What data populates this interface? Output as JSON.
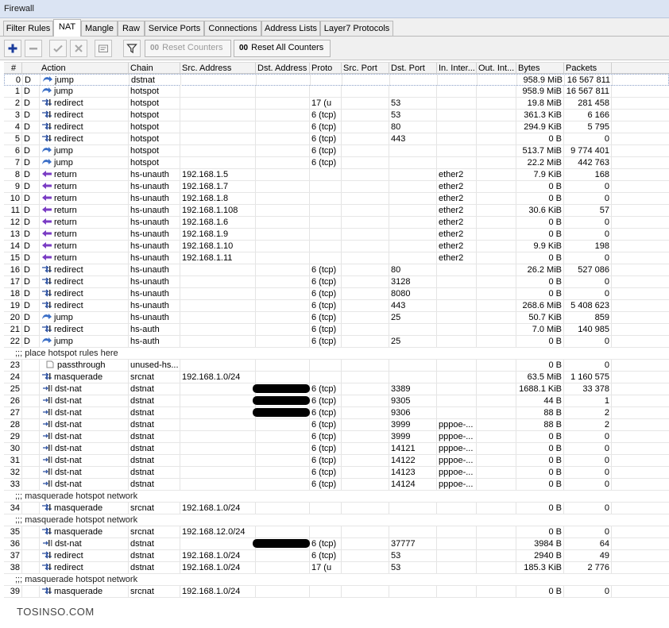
{
  "window": {
    "title": "Firewall"
  },
  "tabs": [
    {
      "label": "Filter Rules",
      "active": false
    },
    {
      "label": "NAT",
      "active": true
    },
    {
      "label": "Mangle",
      "active": false
    },
    {
      "label": "Raw",
      "active": false
    },
    {
      "label": "Service Ports",
      "active": false
    },
    {
      "label": "Connections",
      "active": false
    },
    {
      "label": "Address Lists",
      "active": false
    },
    {
      "label": "Layer7 Protocols",
      "active": false
    }
  ],
  "toolbar": {
    "icons": [
      "add-icon",
      "remove-icon",
      "enable-icon",
      "disable-icon",
      "comment-icon",
      "filter-icon"
    ],
    "reset_counters_prefix": "00",
    "reset_counters_label": "Reset Counters",
    "reset_all_prefix": "00",
    "reset_all_label": "Reset All Counters"
  },
  "columns": [
    "#",
    "Action",
    "Chain",
    "Src. Address",
    "Dst. Address",
    "Proto",
    "Src. Port",
    "Dst. Port",
    "In. Inter...",
    "Out. Int...",
    "Bytes",
    "Packets"
  ],
  "colors": {
    "accent_plus": "#1a3c9c",
    "redirect_arrow": "#2a4fa0",
    "return_arrow": "#7a3cc4",
    "jump_arrow": "#3b6fc7"
  },
  "rows": [
    {
      "type": "rule",
      "num": "0",
      "flag": "D",
      "action": "jump",
      "icon": "jump",
      "chain": "dstnat",
      "src": "",
      "dst": "",
      "proto": "",
      "sport": "",
      "dport": "",
      "inif": "",
      "outif": "",
      "bytes": "958.9 MiB",
      "packets": "16 567 811"
    },
    {
      "type": "rule",
      "num": "1",
      "flag": "D",
      "action": "jump",
      "icon": "jump",
      "chain": "hotspot",
      "src": "",
      "dst": "",
      "proto": "",
      "sport": "",
      "dport": "",
      "inif": "",
      "outif": "",
      "bytes": "958.9 MiB",
      "packets": "16 567 811"
    },
    {
      "type": "rule",
      "num": "2",
      "flag": "D",
      "action": "redirect",
      "icon": "redirect",
      "chain": "hotspot",
      "src": "",
      "dst": "",
      "proto": "17 (u",
      "sport": "",
      "dport": "53",
      "inif": "",
      "outif": "",
      "bytes": "19.8 MiB",
      "packets": "281 458"
    },
    {
      "type": "rule",
      "num": "3",
      "flag": "D",
      "action": "redirect",
      "icon": "redirect",
      "chain": "hotspot",
      "src": "",
      "dst": "",
      "proto": "6 (tcp)",
      "sport": "",
      "dport": "53",
      "inif": "",
      "outif": "",
      "bytes": "361.3 KiB",
      "packets": "6 166"
    },
    {
      "type": "rule",
      "num": "4",
      "flag": "D",
      "action": "redirect",
      "icon": "redirect",
      "chain": "hotspot",
      "src": "",
      "dst": "",
      "proto": "6 (tcp)",
      "sport": "",
      "dport": "80",
      "inif": "",
      "outif": "",
      "bytes": "294.9 KiB",
      "packets": "5 795"
    },
    {
      "type": "rule",
      "num": "5",
      "flag": "D",
      "action": "redirect",
      "icon": "redirect",
      "chain": "hotspot",
      "src": "",
      "dst": "",
      "proto": "6 (tcp)",
      "sport": "",
      "dport": "443",
      "inif": "",
      "outif": "",
      "bytes": "0 B",
      "packets": "0"
    },
    {
      "type": "rule",
      "num": "6",
      "flag": "D",
      "action": "jump",
      "icon": "jump",
      "chain": "hotspot",
      "src": "",
      "dst": "",
      "proto": "6 (tcp)",
      "sport": "",
      "dport": "",
      "inif": "",
      "outif": "",
      "bytes": "513.7 MiB",
      "packets": "9 774 401"
    },
    {
      "type": "rule",
      "num": "7",
      "flag": "D",
      "action": "jump",
      "icon": "jump",
      "chain": "hotspot",
      "src": "",
      "dst": "",
      "proto": "6 (tcp)",
      "sport": "",
      "dport": "",
      "inif": "",
      "outif": "",
      "bytes": "22.2 MiB",
      "packets": "442 763"
    },
    {
      "type": "rule",
      "num": "8",
      "flag": "D",
      "action": "return",
      "icon": "return",
      "chain": "hs-unauth",
      "src": "192.168.1.5",
      "dst": "",
      "proto": "",
      "sport": "",
      "dport": "",
      "inif": "ether2",
      "outif": "",
      "bytes": "7.9 KiB",
      "packets": "168"
    },
    {
      "type": "rule",
      "num": "9",
      "flag": "D",
      "action": "return",
      "icon": "return",
      "chain": "hs-unauth",
      "src": "192.168.1.7",
      "dst": "",
      "proto": "",
      "sport": "",
      "dport": "",
      "inif": "ether2",
      "outif": "",
      "bytes": "0 B",
      "packets": "0"
    },
    {
      "type": "rule",
      "num": "10",
      "flag": "D",
      "action": "return",
      "icon": "return",
      "chain": "hs-unauth",
      "src": "192.168.1.8",
      "dst": "",
      "proto": "",
      "sport": "",
      "dport": "",
      "inif": "ether2",
      "outif": "",
      "bytes": "0 B",
      "packets": "0"
    },
    {
      "type": "rule",
      "num": "11",
      "flag": "D",
      "action": "return",
      "icon": "return",
      "chain": "hs-unauth",
      "src": "192.168.1.108",
      "dst": "",
      "proto": "",
      "sport": "",
      "dport": "",
      "inif": "ether2",
      "outif": "",
      "bytes": "30.6 KiB",
      "packets": "57"
    },
    {
      "type": "rule",
      "num": "12",
      "flag": "D",
      "action": "return",
      "icon": "return",
      "chain": "hs-unauth",
      "src": "192.168.1.6",
      "dst": "",
      "proto": "",
      "sport": "",
      "dport": "",
      "inif": "ether2",
      "outif": "",
      "bytes": "0 B",
      "packets": "0"
    },
    {
      "type": "rule",
      "num": "13",
      "flag": "D",
      "action": "return",
      "icon": "return",
      "chain": "hs-unauth",
      "src": "192.168.1.9",
      "dst": "",
      "proto": "",
      "sport": "",
      "dport": "",
      "inif": "ether2",
      "outif": "",
      "bytes": "0 B",
      "packets": "0"
    },
    {
      "type": "rule",
      "num": "14",
      "flag": "D",
      "action": "return",
      "icon": "return",
      "chain": "hs-unauth",
      "src": "192.168.1.10",
      "dst": "",
      "proto": "",
      "sport": "",
      "dport": "",
      "inif": "ether2",
      "outif": "",
      "bytes": "9.9 KiB",
      "packets": "198"
    },
    {
      "type": "rule",
      "num": "15",
      "flag": "D",
      "action": "return",
      "icon": "return",
      "chain": "hs-unauth",
      "src": "192.168.1.11",
      "dst": "",
      "proto": "",
      "sport": "",
      "dport": "",
      "inif": "ether2",
      "outif": "",
      "bytes": "0 B",
      "packets": "0"
    },
    {
      "type": "rule",
      "num": "16",
      "flag": "D",
      "action": "redirect",
      "icon": "redirect",
      "chain": "hs-unauth",
      "src": "",
      "dst": "",
      "proto": "6 (tcp)",
      "sport": "",
      "dport": "80",
      "inif": "",
      "outif": "",
      "bytes": "26.2 MiB",
      "packets": "527 086"
    },
    {
      "type": "rule",
      "num": "17",
      "flag": "D",
      "action": "redirect",
      "icon": "redirect",
      "chain": "hs-unauth",
      "src": "",
      "dst": "",
      "proto": "6 (tcp)",
      "sport": "",
      "dport": "3128",
      "inif": "",
      "outif": "",
      "bytes": "0 B",
      "packets": "0"
    },
    {
      "type": "rule",
      "num": "18",
      "flag": "D",
      "action": "redirect",
      "icon": "redirect",
      "chain": "hs-unauth",
      "src": "",
      "dst": "",
      "proto": "6 (tcp)",
      "sport": "",
      "dport": "8080",
      "inif": "",
      "outif": "",
      "bytes": "0 B",
      "packets": "0"
    },
    {
      "type": "rule",
      "num": "19",
      "flag": "D",
      "action": "redirect",
      "icon": "redirect",
      "chain": "hs-unauth",
      "src": "",
      "dst": "",
      "proto": "6 (tcp)",
      "sport": "",
      "dport": "443",
      "inif": "",
      "outif": "",
      "bytes": "268.6 MiB",
      "packets": "5 408 623"
    },
    {
      "type": "rule",
      "num": "20",
      "flag": "D",
      "action": "jump",
      "icon": "jump",
      "chain": "hs-unauth",
      "src": "",
      "dst": "",
      "proto": "6 (tcp)",
      "sport": "",
      "dport": "25",
      "inif": "",
      "outif": "",
      "bytes": "50.7 KiB",
      "packets": "859"
    },
    {
      "type": "rule",
      "num": "21",
      "flag": "D",
      "action": "redirect",
      "icon": "redirect",
      "chain": "hs-auth",
      "src": "",
      "dst": "",
      "proto": "6 (tcp)",
      "sport": "",
      "dport": "",
      "inif": "",
      "outif": "",
      "bytes": "7.0 MiB",
      "packets": "140 985"
    },
    {
      "type": "rule",
      "num": "22",
      "flag": "D",
      "action": "jump",
      "icon": "jump",
      "chain": "hs-auth",
      "src": "",
      "dst": "",
      "proto": "6 (tcp)",
      "sport": "",
      "dport": "25",
      "inif": "",
      "outif": "",
      "bytes": "0 B",
      "packets": "0"
    },
    {
      "type": "comment",
      "text": ";;; place hotspot rules here"
    },
    {
      "type": "rule",
      "num": "23",
      "flag": "",
      "action": "passthrough",
      "icon": "passthrough",
      "chain": "unused-hs...",
      "src": "",
      "dst": "",
      "proto": "",
      "sport": "",
      "dport": "",
      "inif": "",
      "outif": "",
      "bytes": "0 B",
      "packets": "0"
    },
    {
      "type": "rule",
      "num": "24",
      "flag": "",
      "action": "masquerade",
      "icon": "masquerade",
      "chain": "srcnat",
      "src": "192.168.1.0/24",
      "dst": "",
      "proto": "",
      "sport": "",
      "dport": "",
      "inif": "",
      "outif": "",
      "bytes": "63.5 MiB",
      "packets": "1 160 575"
    },
    {
      "type": "rule",
      "num": "25",
      "flag": "",
      "action": "dst-nat",
      "icon": "dstnat",
      "chain": "dstnat",
      "src": "",
      "dst": "",
      "redacted": true,
      "proto": "6 (tcp)",
      "sport": "",
      "dport": "3389",
      "inif": "",
      "outif": "",
      "bytes": "1688.1 KiB",
      "packets": "33 378"
    },
    {
      "type": "rule",
      "num": "26",
      "flag": "",
      "action": "dst-nat",
      "icon": "dstnat",
      "chain": "dstnat",
      "src": "",
      "dst": "",
      "redacted": true,
      "proto": "6 (tcp)",
      "sport": "",
      "dport": "9305",
      "inif": "",
      "outif": "",
      "bytes": "44 B",
      "packets": "1"
    },
    {
      "type": "rule",
      "num": "27",
      "flag": "",
      "action": "dst-nat",
      "icon": "dstnat",
      "chain": "dstnat",
      "src": "",
      "dst": "",
      "redacted": true,
      "proto": "6 (tcp)",
      "sport": "",
      "dport": "9306",
      "inif": "",
      "outif": "",
      "bytes": "88 B",
      "packets": "2"
    },
    {
      "type": "rule",
      "num": "28",
      "flag": "",
      "action": "dst-nat",
      "icon": "dstnat",
      "chain": "dstnat",
      "src": "",
      "dst": "",
      "proto": "6 (tcp)",
      "sport": "",
      "dport": "3999",
      "inif": "pppoe-...",
      "outif": "",
      "bytes": "88 B",
      "packets": "2"
    },
    {
      "type": "rule",
      "num": "29",
      "flag": "",
      "action": "dst-nat",
      "icon": "dstnat",
      "chain": "dstnat",
      "src": "",
      "dst": "",
      "proto": "6 (tcp)",
      "sport": "",
      "dport": "3999",
      "inif": "pppoe-...",
      "outif": "",
      "bytes": "0 B",
      "packets": "0"
    },
    {
      "type": "rule",
      "num": "30",
      "flag": "",
      "action": "dst-nat",
      "icon": "dstnat",
      "chain": "dstnat",
      "src": "",
      "dst": "",
      "proto": "6 (tcp)",
      "sport": "",
      "dport": "14121",
      "inif": "pppoe-...",
      "outif": "",
      "bytes": "0 B",
      "packets": "0"
    },
    {
      "type": "rule",
      "num": "31",
      "flag": "",
      "action": "dst-nat",
      "icon": "dstnat",
      "chain": "dstnat",
      "src": "",
      "dst": "",
      "proto": "6 (tcp)",
      "sport": "",
      "dport": "14122",
      "inif": "pppoe-...",
      "outif": "",
      "bytes": "0 B",
      "packets": "0"
    },
    {
      "type": "rule",
      "num": "32",
      "flag": "",
      "action": "dst-nat",
      "icon": "dstnat",
      "chain": "dstnat",
      "src": "",
      "dst": "",
      "proto": "6 (tcp)",
      "sport": "",
      "dport": "14123",
      "inif": "pppoe-...",
      "outif": "",
      "bytes": "0 B",
      "packets": "0"
    },
    {
      "type": "rule",
      "num": "33",
      "flag": "",
      "action": "dst-nat",
      "icon": "dstnat",
      "chain": "dstnat",
      "src": "",
      "dst": "",
      "proto": "6 (tcp)",
      "sport": "",
      "dport": "14124",
      "inif": "pppoe-...",
      "outif": "",
      "bytes": "0 B",
      "packets": "0"
    },
    {
      "type": "comment",
      "text": ";;; masquerade hotspot network"
    },
    {
      "type": "rule",
      "num": "34",
      "flag": "",
      "action": "masquerade",
      "icon": "masquerade",
      "chain": "srcnat",
      "src": "192.168.1.0/24",
      "dst": "",
      "proto": "",
      "sport": "",
      "dport": "",
      "inif": "",
      "outif": "",
      "bytes": "0 B",
      "packets": "0"
    },
    {
      "type": "comment",
      "text": ";;; masquerade hotspot network"
    },
    {
      "type": "rule",
      "num": "35",
      "flag": "",
      "action": "masquerade",
      "icon": "masquerade",
      "chain": "srcnat",
      "src": "192.168.12.0/24",
      "dst": "",
      "proto": "",
      "sport": "",
      "dport": "",
      "inif": "",
      "outif": "",
      "bytes": "0 B",
      "packets": "0"
    },
    {
      "type": "rule",
      "num": "36",
      "flag": "",
      "action": "dst-nat",
      "icon": "dstnat",
      "chain": "dstnat",
      "src": "",
      "dst": "",
      "redacted": true,
      "proto": "6 (tcp)",
      "sport": "",
      "dport": "37777",
      "inif": "",
      "outif": "",
      "bytes": "3984 B",
      "packets": "64"
    },
    {
      "type": "rule",
      "num": "37",
      "flag": "",
      "action": "redirect",
      "icon": "redirect",
      "chain": "dstnat",
      "src": "192.168.1.0/24",
      "dst": "",
      "proto": "6 (tcp)",
      "sport": "",
      "dport": "53",
      "inif": "",
      "outif": "",
      "bytes": "2940 B",
      "packets": "49"
    },
    {
      "type": "rule",
      "num": "38",
      "flag": "",
      "action": "redirect",
      "icon": "redirect",
      "chain": "dstnat",
      "src": "192.168.1.0/24",
      "dst": "",
      "proto": "17 (u",
      "sport": "",
      "dport": "53",
      "inif": "",
      "outif": "",
      "bytes": "185.3 KiB",
      "packets": "2 776"
    },
    {
      "type": "comment",
      "text": ";;; masquerade hotspot network"
    },
    {
      "type": "rule",
      "num": "39",
      "flag": "",
      "action": "masquerade",
      "icon": "masquerade",
      "chain": "srcnat",
      "src": "192.168.1.0/24",
      "dst": "",
      "proto": "",
      "sport": "",
      "dport": "",
      "inif": "",
      "outif": "",
      "bytes": "0 B",
      "packets": "0"
    }
  ],
  "watermark": "TOSINSO.COM"
}
